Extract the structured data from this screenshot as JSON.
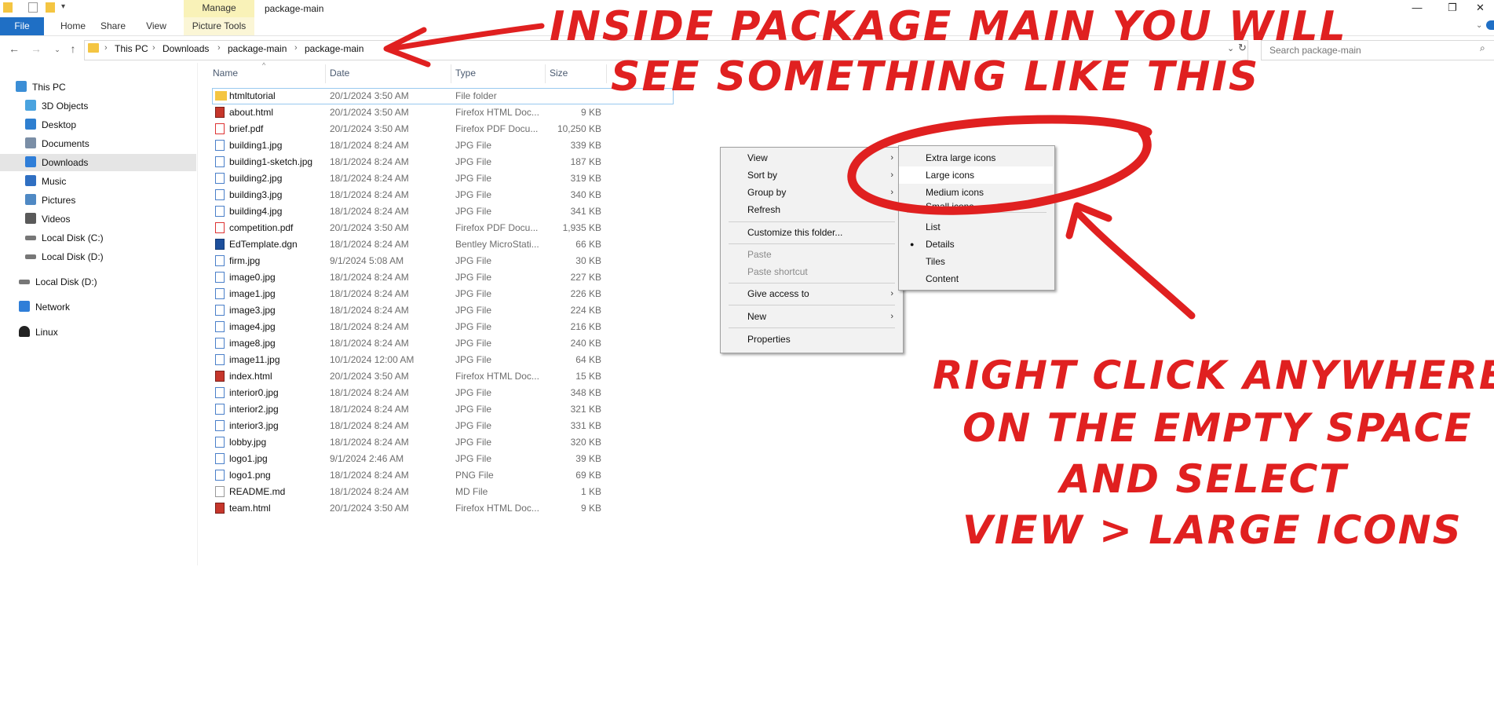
{
  "titlebar": {
    "manage_tab": "Manage",
    "window_title": "package-main",
    "controls": {
      "minimize": "—",
      "restore": "❐",
      "close": "✕"
    }
  },
  "ribbon": {
    "tabs": [
      "File",
      "Home",
      "Share",
      "View",
      "Picture Tools"
    ]
  },
  "address": {
    "crumbs": [
      "This PC",
      "Downloads",
      "package-main",
      "package-main"
    ]
  },
  "search": {
    "placeholder": "Search package-main"
  },
  "sidebar": {
    "items": [
      {
        "label": "This PC",
        "icon": "computer-icon",
        "color": "#3b8ed6"
      },
      {
        "label": "3D Objects",
        "icon": "cube-icon",
        "color": "#4aa3df"
      },
      {
        "label": "Desktop",
        "icon": "desktop-icon",
        "color": "#2e7fd0"
      },
      {
        "label": "Documents",
        "icon": "document-icon",
        "color": "#7a8ea6"
      },
      {
        "label": "Downloads",
        "icon": "download-icon",
        "color": "#2f7ed8"
      },
      {
        "label": "Music",
        "icon": "music-icon",
        "color": "#2f6fc2"
      },
      {
        "label": "Pictures",
        "icon": "picture-icon",
        "color": "#4f89c4"
      },
      {
        "label": "Videos",
        "icon": "video-icon",
        "color": "#5a5a5a"
      },
      {
        "label": "Local Disk (C:)",
        "icon": "drive-icon",
        "color": "#777777"
      },
      {
        "label": "Local Disk (D:)",
        "icon": "drive-icon",
        "color": "#777777"
      },
      {
        "label": "Local Disk (D:)",
        "icon": "drive-icon",
        "color": "#777777"
      },
      {
        "label": "Network",
        "icon": "network-icon",
        "color": "#2f7ed8"
      },
      {
        "label": "Linux",
        "icon": "linux-icon",
        "color": "#222222"
      }
    ]
  },
  "columns": {
    "name": "Name",
    "date": "Date",
    "type": "Type",
    "size": "Size"
  },
  "files": [
    {
      "name": "htmltutorial",
      "date": "20/1/2024 3:50 AM",
      "type": "File folder",
      "size": "",
      "icon": "folder-icon"
    },
    {
      "name": "about.html",
      "date": "20/1/2024 3:50 AM",
      "type": "Firefox HTML Doc...",
      "size": "9 KB",
      "icon": "html-icon"
    },
    {
      "name": "brief.pdf",
      "date": "20/1/2024 3:50 AM",
      "type": "Firefox PDF Docu...",
      "size": "10,250 KB",
      "icon": "pdf-icon"
    },
    {
      "name": "building1.jpg",
      "date": "18/1/2024 8:24 AM",
      "type": "JPG File",
      "size": "339 KB",
      "icon": "image-icon"
    },
    {
      "name": "building1-sketch.jpg",
      "date": "18/1/2024 8:24 AM",
      "type": "JPG File",
      "size": "187 KB",
      "icon": "image-icon"
    },
    {
      "name": "building2.jpg",
      "date": "18/1/2024 8:24 AM",
      "type": "JPG File",
      "size": "319 KB",
      "icon": "image-icon"
    },
    {
      "name": "building3.jpg",
      "date": "18/1/2024 8:24 AM",
      "type": "JPG File",
      "size": "340 KB",
      "icon": "image-icon"
    },
    {
      "name": "building4.jpg",
      "date": "18/1/2024 8:24 AM",
      "type": "JPG File",
      "size": "341 KB",
      "icon": "image-icon"
    },
    {
      "name": "competition.pdf",
      "date": "20/1/2024 3:50 AM",
      "type": "Firefox PDF Docu...",
      "size": "1,935 KB",
      "icon": "pdf-icon"
    },
    {
      "name": "EdTemplate.dgn",
      "date": "18/1/2024 8:24 AM",
      "type": "Bentley MicroStati...",
      "size": "66 KB",
      "icon": "dgn-icon"
    },
    {
      "name": "firm.jpg",
      "date": "9/1/2024 5:08 AM",
      "type": "JPG File",
      "size": "30 KB",
      "icon": "image-icon"
    },
    {
      "name": "image0.jpg",
      "date": "18/1/2024 8:24 AM",
      "type": "JPG File",
      "size": "227 KB",
      "icon": "image-icon"
    },
    {
      "name": "image1.jpg",
      "date": "18/1/2024 8:24 AM",
      "type": "JPG File",
      "size": "226 KB",
      "icon": "image-icon"
    },
    {
      "name": "image3.jpg",
      "date": "18/1/2024 8:24 AM",
      "type": "JPG File",
      "size": "224 KB",
      "icon": "image-icon"
    },
    {
      "name": "image4.jpg",
      "date": "18/1/2024 8:24 AM",
      "type": "JPG File",
      "size": "216 KB",
      "icon": "image-icon"
    },
    {
      "name": "image8.jpg",
      "date": "18/1/2024 8:24 AM",
      "type": "JPG File",
      "size": "240 KB",
      "icon": "image-icon"
    },
    {
      "name": "image11.jpg",
      "date": "10/1/2024 12:00 AM",
      "type": "JPG File",
      "size": "64 KB",
      "icon": "image-icon"
    },
    {
      "name": "index.html",
      "date": "20/1/2024 3:50 AM",
      "type": "Firefox HTML Doc...",
      "size": "15 KB",
      "icon": "html-icon"
    },
    {
      "name": "interior0.jpg",
      "date": "18/1/2024 8:24 AM",
      "type": "JPG File",
      "size": "348 KB",
      "icon": "image-icon"
    },
    {
      "name": "interior2.jpg",
      "date": "18/1/2024 8:24 AM",
      "type": "JPG File",
      "size": "321 KB",
      "icon": "image-icon"
    },
    {
      "name": "interior3.jpg",
      "date": "18/1/2024 8:24 AM",
      "type": "JPG File",
      "size": "331 KB",
      "icon": "image-icon"
    },
    {
      "name": "lobby.jpg",
      "date": "18/1/2024 8:24 AM",
      "type": "JPG File",
      "size": "320 KB",
      "icon": "image-icon"
    },
    {
      "name": "logo1.jpg",
      "date": "9/1/2024 2:46 AM",
      "type": "JPG File",
      "size": "39 KB",
      "icon": "image-icon"
    },
    {
      "name": "logo1.png",
      "date": "18/1/2024 8:24 AM",
      "type": "PNG File",
      "size": "69 KB",
      "icon": "image-icon"
    },
    {
      "name": "README.md",
      "date": "18/1/2024 8:24 AM",
      "type": "MD File",
      "size": "1 KB",
      "icon": "text-file-icon"
    },
    {
      "name": "team.html",
      "date": "20/1/2024 3:50 AM",
      "type": "Firefox HTML Doc...",
      "size": "9 KB",
      "icon": "html-icon"
    }
  ],
  "context_menu": {
    "view": "View",
    "sort_by": "Sort by",
    "group_by": "Group by",
    "refresh": "Refresh",
    "customize": "Customize this folder...",
    "paste": "Paste",
    "paste_shortcut": "Paste shortcut",
    "give_access": "Give access to",
    "new": "New",
    "properties": "Properties"
  },
  "view_submenu": {
    "extra_large": "Extra large icons",
    "large": "Large icons",
    "medium": "Medium icons",
    "small": "Small icons",
    "list": "List",
    "details": "Details",
    "tiles": "Tiles",
    "content": "Content",
    "selected_bullet": "●"
  },
  "annotations": {
    "top_line1": "INSIDE PACKAGE MAIN YOU WILL",
    "top_line2": "SEE SOMETHING LIKE THIS",
    "bottom_line1": "RIGHT CLICK ANYWHERE",
    "bottom_line2": "ON THE EMPTY SPACE",
    "bottom_line3": "AND SELECT",
    "bottom_line4": "VIEW > LARGE ICONS",
    "color": "#e02020"
  }
}
